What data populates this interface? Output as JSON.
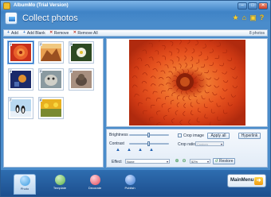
{
  "window": {
    "title": "AlbumMo (Trial Version)",
    "controls": {
      "minimize": "–",
      "maximize": "□",
      "close": "✕"
    }
  },
  "header": {
    "title": "Collect photos",
    "icons": [
      "star-icon",
      "home-icon",
      "lock-icon",
      "help-icon"
    ]
  },
  "toolbar": {
    "add_label": "Add",
    "add_blank_label": "Add Blank",
    "remove_label": "Remove",
    "remove_all_label": "Remove All",
    "count": "8 photos"
  },
  "thumbnails": [
    {
      "num": "1",
      "selected": true,
      "colors": [
        "#d8401c",
        "#f07a2a"
      ]
    },
    {
      "num": "2",
      "selected": false,
      "colors": [
        "#c87030",
        "#e8b060"
      ]
    },
    {
      "num": "3",
      "selected": false,
      "colors": [
        "#3a5a2a",
        "#e8e8d0"
      ]
    },
    {
      "num": "4",
      "selected": false,
      "colors": [
        "#1a3a80",
        "#e0a040"
      ]
    },
    {
      "num": "5",
      "selected": false,
      "colors": [
        "#5a6a70",
        "#c8c8c0"
      ]
    },
    {
      "num": "6",
      "selected": false,
      "colors": [
        "#5a4a40",
        "#c0a890"
      ]
    },
    {
      "num": "7",
      "selected": false,
      "colors": [
        "#a0c8e8",
        "#202020"
      ]
    },
    {
      "num": "8",
      "selected": false,
      "colors": [
        "#e0a020",
        "#7a8a30"
      ]
    }
  ],
  "controls": {
    "brightness_label": "Brightness",
    "contrast_label": "Contrast",
    "crop_image_label": "Crop image",
    "crop_ratio_label": "Crop ratio",
    "crop_ratio_value": "Custom",
    "apply_all_label": "Apply all",
    "hyperlink_label": "Hyperlink",
    "effect_label": "Effect",
    "effect_value": "None",
    "zoom_value": "52%",
    "restore_label": "Restore"
  },
  "bottom_nav": {
    "items": [
      {
        "label": "Photo",
        "active": true,
        "color": "#3a9ae0"
      },
      {
        "label": "Template",
        "active": false,
        "color": "#5ab04a"
      },
      {
        "label": "Decorate",
        "active": false,
        "color": "#e04a5a"
      },
      {
        "label": "Publish",
        "active": false,
        "color": "#3a7ad0"
      }
    ],
    "main_menu_label": "MainMenu"
  },
  "colors": {
    "accent": "#3f83c6",
    "flower_outer": "#d8401c",
    "flower_inner": "#f5a050"
  }
}
